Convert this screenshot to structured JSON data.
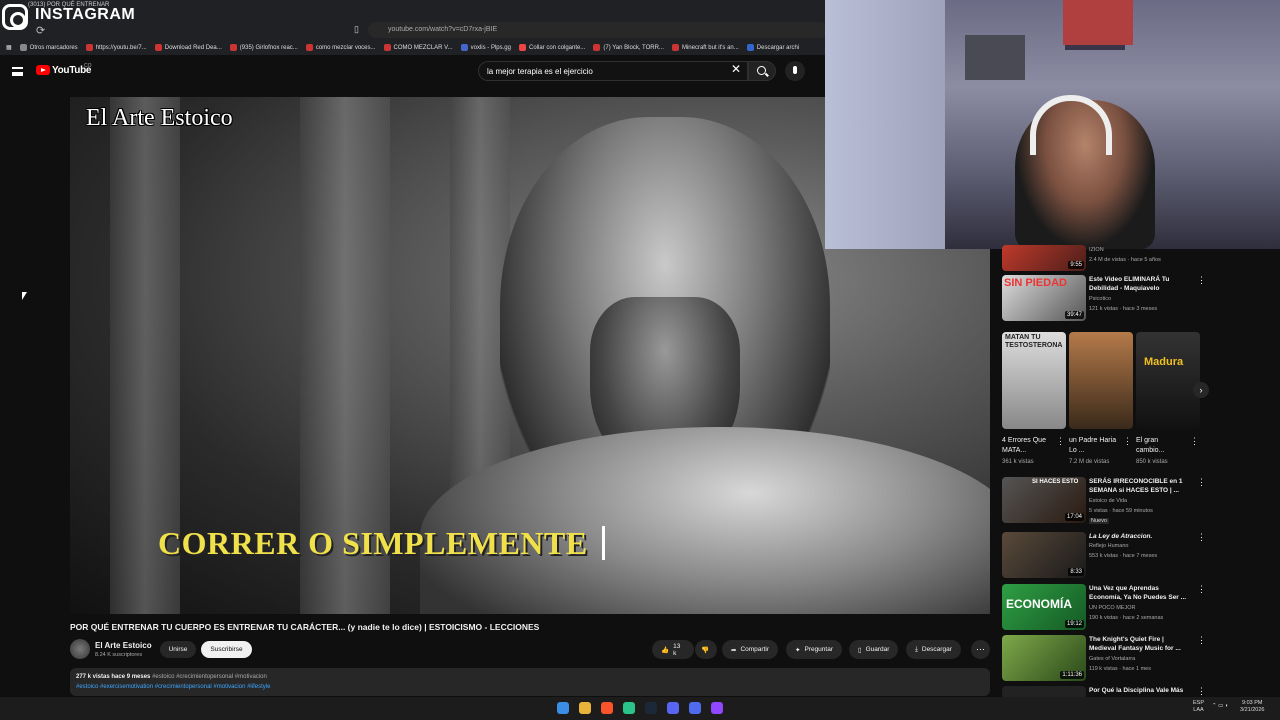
{
  "overlay": {
    "app_name": "INSTAGRAM",
    "tab_hint": "(3013) POR QUÉ ENTRENAR"
  },
  "browser": {
    "url": "youtube.com/watch?v=cD7rxa-jBIE",
    "bookmarks": [
      "Otros marcadores",
      "https://youtu.be/7...",
      "Download Red Dea...",
      "(935) Girlofnox reac...",
      "como mezclar voces...",
      "COMO MEZCLAR V...",
      "voxlis - Plps.gg",
      "Collar con colgante...",
      "(7) Yan Block, TORR...",
      "Minecraft but it's an...",
      "Descargar archi"
    ]
  },
  "youtube": {
    "logo_text": "YouTube",
    "country": "CO",
    "search_value": "la mejor terapia es el ejercicio"
  },
  "video": {
    "watermark": "El Arte Estoico",
    "subtitle": "CORRER O SIMPLEMENTE",
    "title": "POR QUÉ ENTRENAR TU CUERPO ES ENTRENAR TU CARÁCTER... (y nadie te lo dice) | ESTOICISMO - LECCIONES",
    "channel": "El Arte Estoico",
    "subscribers": "8.24 K suscriptores",
    "join_label": "Unirse",
    "subscribe_label": "Suscribirse",
    "likes": "13 k",
    "share_label": "Compartir",
    "ask_label": "Preguntar",
    "save_label": "Guardar",
    "download_label": "Descargar",
    "stats": "277 k vistas  hace 9 meses",
    "tags_line1": "#estoico #crecimientopersonal #motivacion",
    "tags_line2": "#estoico #exercisemotivation #crecimientopersonal #motivacion #lifestyle"
  },
  "sidebar": {
    "top_card": {
      "channel": "IZION",
      "meta": "2.4 M de vistas · hace 5 años",
      "duration": "9:55"
    },
    "items": [
      {
        "title": "Este Video ELIMINARÁ Tu Debilidad - Maquiavelo",
        "channel": "Psicotico",
        "meta": "121 k vistas · hace 3 meses",
        "duration": "39:47",
        "thumb_text": "SIN PIEDAD"
      },
      {
        "title": "SERÁS IRRECONOCIBLE en 1 SEMANA si HACES ESTO | ...",
        "channel": "Estoico de Vida",
        "meta": "5 vistas · hace 59 minutos",
        "badge": "Nuevo",
        "duration": "17:04",
        "thumb_text": "SI HACES ESTO"
      },
      {
        "title": "La Ley de Atraccion.",
        "channel": "Reflejo Humano",
        "meta": "553 k vistas · hace 7 meses",
        "duration": "8:33"
      },
      {
        "title": "Una Vez que Aprendas Economía, Ya No Puedes Ser ...",
        "channel": "UN POCO MEJOR",
        "meta": "190 k vistas · hace 2 semanas",
        "duration": "19:12",
        "thumb_text": "ECONOMÍA"
      },
      {
        "title": "The Knight's Quiet Fire | Medieval Fantasy Music for ...",
        "channel": "Gates of Vortalarra",
        "meta": "119 k vistas · hace 1 mes",
        "duration": "1:11:36"
      },
      {
        "title": "Por Qué la Disciplina Vale Más",
        "channel": "",
        "meta": "",
        "duration": ""
      }
    ],
    "shorts": [
      {
        "title": "4 Errores Que MATA...",
        "views": "361 k vistas",
        "thumb_text": "MATAN TU TESTOSTERONA"
      },
      {
        "title": "un Padre Haria Lo ...",
        "views": "7.2 M de vistas",
        "thumb_text": ""
      },
      {
        "title": "El gran cambio...",
        "views": "850 k vistas",
        "thumb_text": "Madura"
      }
    ]
  },
  "taskbar": {
    "lang": "ESP",
    "lang2": "LAA",
    "time": "9:03 PM",
    "date": "3/21/2026"
  },
  "colors": {
    "yt_red": "#ff0000",
    "link_blue": "#3ea6ff",
    "subtitle_yellow": "#f0e04a"
  }
}
